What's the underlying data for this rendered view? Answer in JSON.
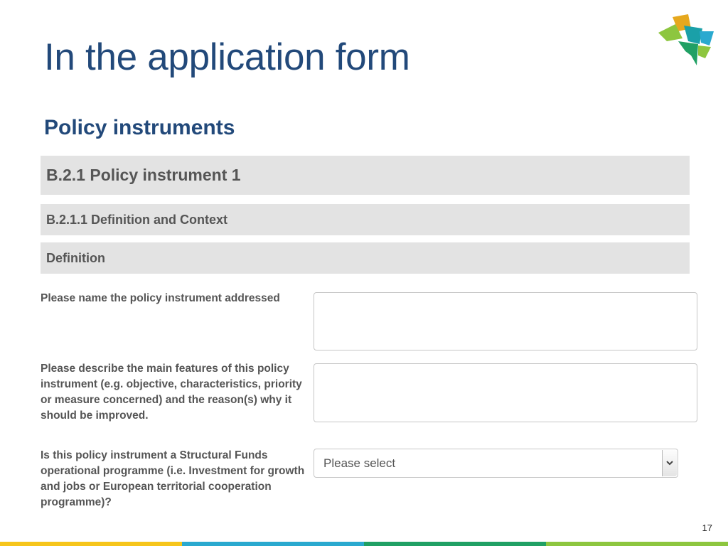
{
  "slide": {
    "title": "In the application form",
    "subtitle": "Policy instruments",
    "page_number": "17"
  },
  "form": {
    "section_header": "B.2.1 Policy instrument 1",
    "subsection_header": "B.2.1.1 Definition and Context",
    "group_header": "Definition",
    "questions": [
      {
        "label": "Please name the policy instrument addressed",
        "value": ""
      },
      {
        "label": "Please describe the main features of this policy instrument (e.g. objective, characteristics, priority or measure concerned) and the reason(s) why it should be improved.",
        "value": ""
      },
      {
        "label": "Is this policy instrument a Structural Funds operational programme (i.e. Investment for growth and jobs or European territorial cooperation programme)?",
        "selected": "Please select"
      }
    ]
  },
  "colors": {
    "title": "#22497a",
    "bar_background": "#e3e3e3",
    "footer": [
      "#f6c51b",
      "#2aa9cf",
      "#20a064",
      "#8dc63f"
    ],
    "logo": [
      "#e6a81e",
      "#8dc63f",
      "#1aa0a8",
      "#20a064",
      "#2aa9cf"
    ]
  },
  "icons": {
    "logo": "interreg-europe-logo",
    "dropdown": "chevron-down-icon"
  }
}
